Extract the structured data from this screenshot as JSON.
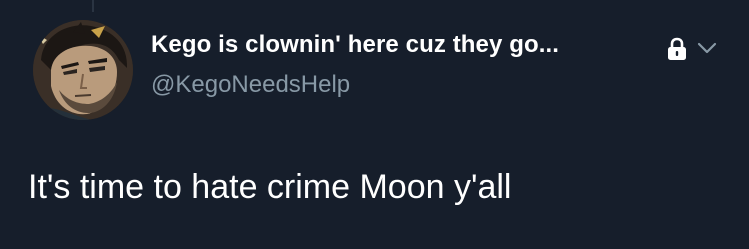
{
  "tweet": {
    "author": {
      "display_name": "Kego is clownin' here cuz they go...",
      "handle": "@KegoNeedsHelp",
      "avatar": "anime-character-portrait"
    },
    "text": "It's time to hate crime Moon y'all",
    "icons": {
      "protected": "lock-icon",
      "menu": "chevron-down-icon"
    }
  },
  "colors": {
    "background": "#161e2b",
    "primary_text": "#ffffff",
    "secondary_text": "#8899a6"
  }
}
